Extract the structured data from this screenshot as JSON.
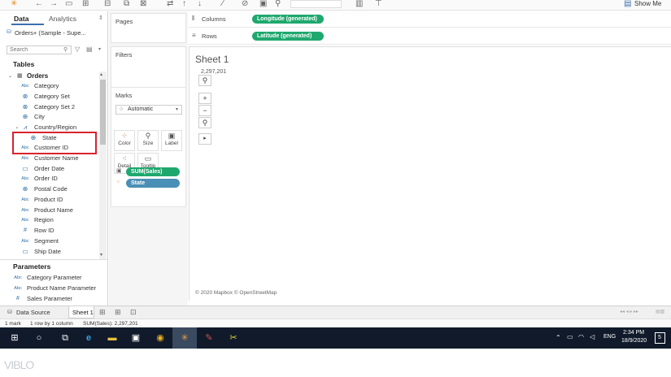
{
  "toolbar": {
    "show_me": "Show Me"
  },
  "data_pane": {
    "tab_data": "Data",
    "tab_analytics": "Analytics",
    "data_source": "Orders+ (Sample - Supe...",
    "search_placeholder": "Search",
    "tables_heading": "Tables",
    "table_name": "Orders",
    "fields": [
      {
        "label": "Category",
        "icon": "Abc"
      },
      {
        "label": "Category Set",
        "icon": "set-icon"
      },
      {
        "label": "Category Set 2",
        "icon": "set-icon"
      },
      {
        "label": "City",
        "icon": "globe-icon"
      },
      {
        "label": "Country/Region",
        "icon": "hierarchy-icon"
      },
      {
        "label": "State",
        "icon": "globe-icon"
      },
      {
        "label": "Customer ID",
        "icon": "Abc"
      },
      {
        "label": "Customer Name",
        "icon": "Abc"
      },
      {
        "label": "Order Date",
        "icon": "calendar-icon"
      },
      {
        "label": "Order ID",
        "icon": "Abc"
      },
      {
        "label": "Postal Code",
        "icon": "globe-icon"
      },
      {
        "label": "Product ID",
        "icon": "Abc"
      },
      {
        "label": "Product Name",
        "icon": "Abc"
      },
      {
        "label": "Region",
        "icon": "Abc"
      },
      {
        "label": "Row ID",
        "icon": "#"
      },
      {
        "label": "Segment",
        "icon": "Abc"
      },
      {
        "label": "Ship Date",
        "icon": "calendar-icon"
      }
    ],
    "parameters_heading": "Parameters",
    "parameters": [
      {
        "label": "Category Parameter",
        "icon": "Abc"
      },
      {
        "label": "Product Name Parameter",
        "icon": "Abc"
      },
      {
        "label": "Sales Parameter",
        "icon": "#"
      }
    ],
    "highlight_color": "#d9232e"
  },
  "cards": {
    "pages": "Pages",
    "filters": "Filters",
    "marks": "Marks",
    "mark_type": "Automatic",
    "buttons": {
      "color": "Color",
      "size": "Size",
      "label": "Label",
      "detail": "Detail",
      "tooltip": "Tooltip"
    },
    "pills": {
      "sum_sales": "SUM(Sales)",
      "state": "State"
    }
  },
  "shelves": {
    "columns_label": "Columns",
    "columns_pill": "Longitude (generated)",
    "rows_label": "Rows",
    "rows_pill": "Latitude (generated)"
  },
  "view": {
    "sheet_title": "Sheet 1",
    "value": "2,297,201",
    "attribution": "© 2020 Mapbox © OpenStreetMap"
  },
  "bottom": {
    "data_source_tab": "Data Source",
    "sheet_tab": "Sheet 1",
    "status_marks": "1 mark",
    "status_rows": "1 row by 1 column",
    "status_sum": "SUM(Sales): 2,297,201"
  },
  "taskbar": {
    "lang": "ENG",
    "time": "2:34 PM",
    "date": "18/9/2020",
    "notif_count": "5"
  },
  "watermark": "VIBLO",
  "colors": {
    "green_pill": "#1fa86e",
    "blue_pill": "#4a8fb5",
    "taskbar": "#101a2a"
  }
}
